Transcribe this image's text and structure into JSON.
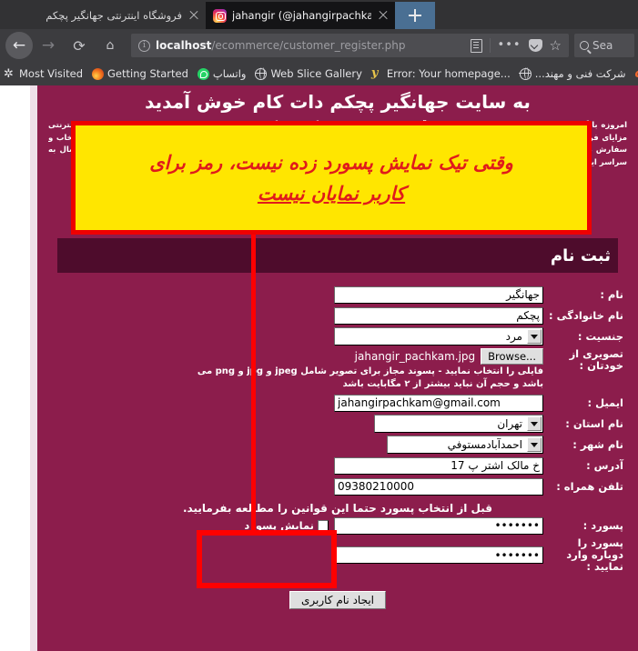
{
  "browser": {
    "tabs": [
      {
        "title": "فروشگاه اینترنتی جهانگیر پچکم",
        "active": false,
        "favicon": "none",
        "close_icon": "close-icon"
      },
      {
        "title": "jahangir (@jahangirpachkam) • Ins",
        "active": true,
        "favicon": "instagram-icon",
        "close_icon": "close-icon"
      }
    ],
    "new_tab_label": "+",
    "nav": {
      "back_icon": "back-arrow-icon",
      "forward_icon": "forward-arrow-icon",
      "reload_icon": "reload-icon",
      "home_icon": "home-icon"
    },
    "url": {
      "info_icon": "info-icon",
      "host": "localhost",
      "path": "/ecommerce/customer_register.php",
      "reader_icon": "reader-view-icon",
      "menu_icon": "page-actions-icon",
      "pocket_icon": "pocket-icon",
      "star_icon": "bookmark-star-icon"
    },
    "search": {
      "icon": "search-icon",
      "placeholder": "Sea"
    },
    "bookmarks": [
      {
        "label": "Most Visited",
        "icon": "gear-icon"
      },
      {
        "label": "Getting Started",
        "icon": "firefox-icon"
      },
      {
        "label": "واتساپ",
        "icon": "whatsapp-icon",
        "rtl": true
      },
      {
        "label": "Web Slice Gallery",
        "icon": "globe-icon"
      },
      {
        "label": "Error: Your homepage...",
        "icon": "yahoo-icon"
      },
      {
        "label": "شرکت فنی و مهند...",
        "icon": "globe-icon",
        "rtl": true
      },
      {
        "label": "",
        "icon": "cp-icon"
      }
    ]
  },
  "page": {
    "welcome": "به سایت جهانگیر پچکم دات کام خوش آمدید",
    "intro": "امروزه با گسترش روز افزون اینترنت و استفاده از آن در تمامی عرصه های زندگی، فروشگاه های اینترنتی نیز رونق فراوانی یافته اند. خرید اینترنتی مزایای فراوانی دارد و در وقت و هزینه شما صرفه جویی می کند. در فروشگاه اینترنتی جهانگیر پچکم شما می توانید کالای مورد نظر خود را انتخاب و سفارش دهید و در کمترین زمان ممکن آن را در محل خود تحویل بگیرید. تایید مرجوعی کالا و ضمانت بازگشت وجه از دیگر خدمات ماست. ارسال به سراسر ایران قرار دارد. همچنین می توانید جهت مشاهده محصولات و خرید از فروشگاه ثبت نام نمایید.",
    "section_title": "ثبت نام",
    "form": {
      "fields": [
        {
          "name": "first-name",
          "label": "نام :",
          "type": "text",
          "value": "جهانگیر",
          "dir": "rtl"
        },
        {
          "name": "last-name",
          "label": "نام خانوادگی :",
          "type": "text",
          "value": "پچکم",
          "dir": "rtl"
        },
        {
          "name": "gender",
          "label": "جنسیت :",
          "type": "select",
          "value": "مرد"
        },
        {
          "name": "email",
          "label": "ایمیل :",
          "type": "text",
          "value": "jahangirpachkam@gmail.com",
          "dir": "ltr"
        },
        {
          "name": "state",
          "label": "نام استان :",
          "type": "select",
          "value": "تهران"
        },
        {
          "name": "city",
          "label": "نام شهر :",
          "type": "select",
          "value": "احمدآبادمستوفي"
        },
        {
          "name": "address",
          "label": "آدرس :",
          "type": "text",
          "value": "خ مالک اشتر پ 17",
          "dir": "rtl"
        },
        {
          "name": "mobile",
          "label": "تلفن همراه :",
          "type": "text",
          "value": "09380210000",
          "dir": "ltr"
        }
      ],
      "photo": {
        "label": "تصویری از خودتان :",
        "browse_label": "Browse...",
        "file_name": "jahangir_pachkam.jpg",
        "hint": "فایلی را انتخاب نمایید - پسوند مجاز برای تصویر شامل jpeg و jpg و png می باشد و حجم آن نباید بیشتر از ۲ مگابایت باشد"
      },
      "rules_note": "قبل از انتخاب پسورد حتما این قوانین را مطالعه بفرمایید.",
      "password": {
        "label": "پسورد :",
        "value": "•••••••",
        "show_label": "نمایش پسورد",
        "checkbox_checked": false
      },
      "password_confirm": {
        "label": "پسورد را دوباره وارد نمایید :",
        "value": "•••••••"
      },
      "submit_label": "ایجاد نام کاربری"
    }
  },
  "annotations": {
    "callout": {
      "line1": "وقتی تیک نمایش پسورد زده نیست، رمز برای",
      "line2": "کاربر نمایان نیست",
      "fill_color": "#ffe600",
      "border_color": "#ee0000",
      "text_color": "#e01b1b"
    },
    "pointer_line_color": "#ff0000",
    "highlight_box_color": "#ff0000"
  }
}
